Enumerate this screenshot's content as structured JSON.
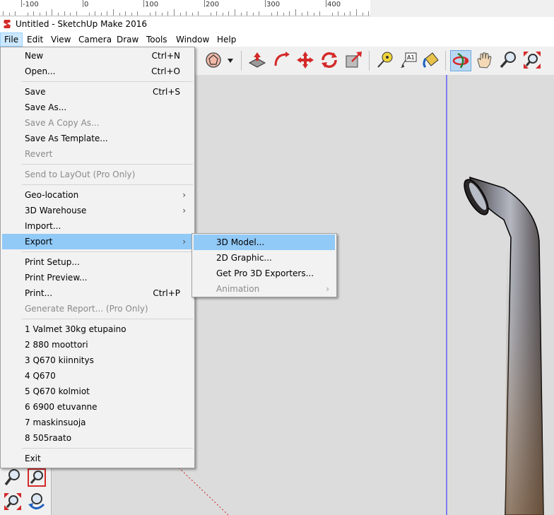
{
  "ruler": {
    "labels": [
      "-100",
      "0",
      "100",
      "200",
      "300",
      "400"
    ]
  },
  "window": {
    "title": "Untitled - SketchUp Make 2016"
  },
  "menubar": {
    "items": [
      "File",
      "Edit",
      "View",
      "Camera",
      "Draw",
      "Tools",
      "Window",
      "Help"
    ]
  },
  "file_menu": {
    "new": {
      "label": "New",
      "shortcut": "Ctrl+N"
    },
    "open": {
      "label": "Open...",
      "shortcut": "Ctrl+O"
    },
    "save": {
      "label": "Save",
      "shortcut": "Ctrl+S"
    },
    "save_as": {
      "label": "Save As..."
    },
    "save_copy_as": {
      "label": "Save A Copy As..."
    },
    "save_as_template": {
      "label": "Save As Template..."
    },
    "revert": {
      "label": "Revert"
    },
    "send_to_layout": {
      "label": "Send to LayOut (Pro Only)"
    },
    "geo_location": {
      "label": "Geo-location"
    },
    "warehouse": {
      "label": "3D Warehouse"
    },
    "import": {
      "label": "Import..."
    },
    "export": {
      "label": "Export"
    },
    "print_setup": {
      "label": "Print Setup..."
    },
    "print_preview": {
      "label": "Print Preview..."
    },
    "print": {
      "label": "Print...",
      "shortcut": "Ctrl+P"
    },
    "generate_report": {
      "label": "Generate Report... (Pro Only)"
    },
    "recent": [
      "1 Valmet 30kg etupaino",
      "2 880 moottori",
      "3 Q670 kiinnitys",
      "4 Q670",
      "5 Q670 kolmiot",
      "6 6900 etuvanne",
      "7 maskinsuoja",
      "8 505raato"
    ],
    "exit": {
      "label": "Exit"
    }
  },
  "export_submenu": {
    "model": {
      "label": "3D Model..."
    },
    "graphic": {
      "label": "2D Graphic..."
    },
    "pro_exporters": {
      "label": "Get Pro 3D Exporters..."
    },
    "animation": {
      "label": "Animation"
    }
  },
  "icons": {
    "toolbar": [
      "polygon-icon",
      "dropdown-arrow-icon",
      "push-pull-icon",
      "follow-me-icon",
      "move-icon",
      "rotate-icon",
      "scale-icon",
      "tape-measure-icon",
      "text-label-icon",
      "paint-bucket-icon",
      "orbit-icon",
      "pan-icon",
      "zoom-icon",
      "zoom-extents-icon"
    ],
    "left": [
      "zoom-icon",
      "zoom-window-icon",
      "zoom-extents-icon",
      "previous-view-icon"
    ]
  },
  "colors": {
    "highlight": "#91c9f7",
    "menu_active": "#cce8ff",
    "axis_blue": "#2020ff",
    "axis_red": "#d02020"
  }
}
